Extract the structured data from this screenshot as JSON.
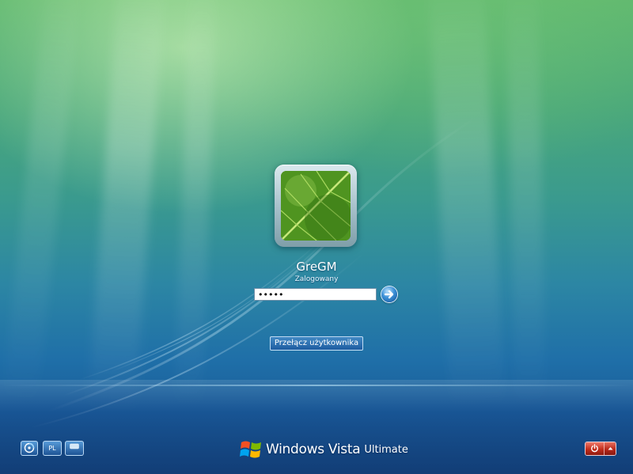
{
  "user": {
    "name": "GreGM",
    "status": "Zalogowany",
    "password_value": "•••••"
  },
  "buttons": {
    "switch_user": "Przełącz użytkownika",
    "language": "PL"
  },
  "brand": {
    "name": "Windows Vista",
    "edition": "Ultimate"
  },
  "icons": {
    "ease_of_access": "ease-of-access-icon",
    "keyboard": "keyboard-icon",
    "submit": "arrow-right-icon",
    "shutdown": "power-icon",
    "options": "chevron-up-icon",
    "windows": "windows-flag-icon"
  },
  "colors": {
    "shutdown_red": "#c22d1c",
    "submit_blue": "#3b8fd6"
  }
}
